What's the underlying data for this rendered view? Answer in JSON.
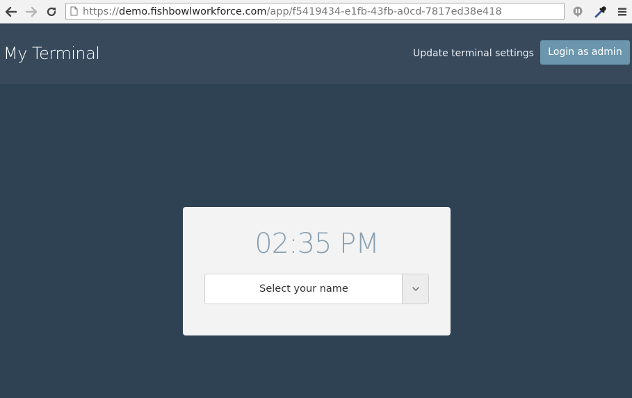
{
  "browser": {
    "url_prefix": "https://",
    "url_host": "demo.fishbowlworkforce.com",
    "url_path": "/app/f5419434-e1fb-43fb-a0cd-7817ed38e418",
    "icons": [
      "back-arrow-icon",
      "forward-arrow-icon",
      "reload-icon",
      "page-icon",
      "extension-icon",
      "eyedropper-icon",
      "menu-icon"
    ]
  },
  "header": {
    "title": "My Terminal",
    "settings_link": "Update terminal settings",
    "login_button": "Login as admin"
  },
  "terminal": {
    "time": "02:35 PM",
    "name_select": {
      "placeholder": "Select your name",
      "icon": "chevron-down-icon"
    }
  },
  "colors": {
    "background": "#2e4254",
    "header": "#37495b",
    "accent_button": "#6b96ad",
    "clock_text": "#8aa1b3",
    "card": "#f3f3f3"
  }
}
